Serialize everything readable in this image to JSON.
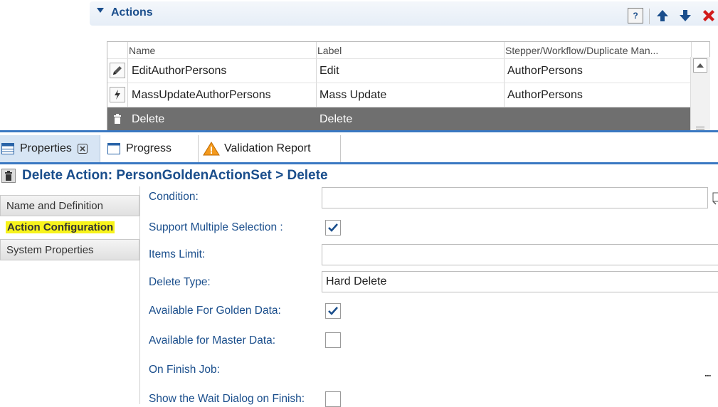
{
  "actions_panel": {
    "title": "Actions",
    "toolbar": {
      "help_glyph": "?",
      "move_up": "move-up",
      "move_down": "move-down",
      "delete": "delete"
    },
    "columns": [
      "Name",
      "Label",
      "Stepper/Workflow/Duplicate Man..."
    ],
    "rows": [
      {
        "icon": "pencil-icon",
        "name": "EditAuthorPersons",
        "label": "Edit",
        "target": "AuthorPersons",
        "selected": false
      },
      {
        "icon": "lightning-icon",
        "name": "MassUpdateAuthorPersons",
        "label": "Mass Update",
        "target": "AuthorPersons",
        "selected": false
      },
      {
        "icon": "trash-icon",
        "name": "Delete",
        "label": "Delete",
        "target": "",
        "selected": true
      }
    ]
  },
  "tabs": [
    {
      "label": "Properties",
      "icon": "table-icon",
      "active": true,
      "closable": true
    },
    {
      "label": "Progress",
      "icon": "window-icon",
      "active": false
    },
    {
      "label": "Validation Report",
      "icon": "warning-icon",
      "active": false
    }
  ],
  "properties": {
    "title": "Delete Action: PersonGoldenActionSet > Delete",
    "nav": [
      "Name and Definition",
      "Action Configuration",
      "System Properties"
    ],
    "active_nav": "Action Configuration",
    "fields": {
      "condition": {
        "label": "Condition:",
        "value": ""
      },
      "support_multiple": {
        "label": "Support Multiple Selection :",
        "checked": true
      },
      "items_limit": {
        "label": "Items Limit:",
        "value": ""
      },
      "delete_type": {
        "label": "Delete Type:",
        "value": "Hard Delete"
      },
      "available_golden": {
        "label": "Available For Golden Data:",
        "checked": true
      },
      "available_master": {
        "label": "Available for Master Data:",
        "checked": false
      },
      "on_finish_job": {
        "label": "On Finish Job:",
        "more": "..."
      },
      "show_wait": {
        "label": "Show the Wait Dialog on Finish:",
        "checked": false
      }
    }
  },
  "colors": {
    "accent": "#1a4e8c",
    "tab_line": "#3a78c2",
    "selected_row": "#6f6f6f",
    "highlight": "#f7f31b",
    "delete_red": "#d11a1a"
  }
}
